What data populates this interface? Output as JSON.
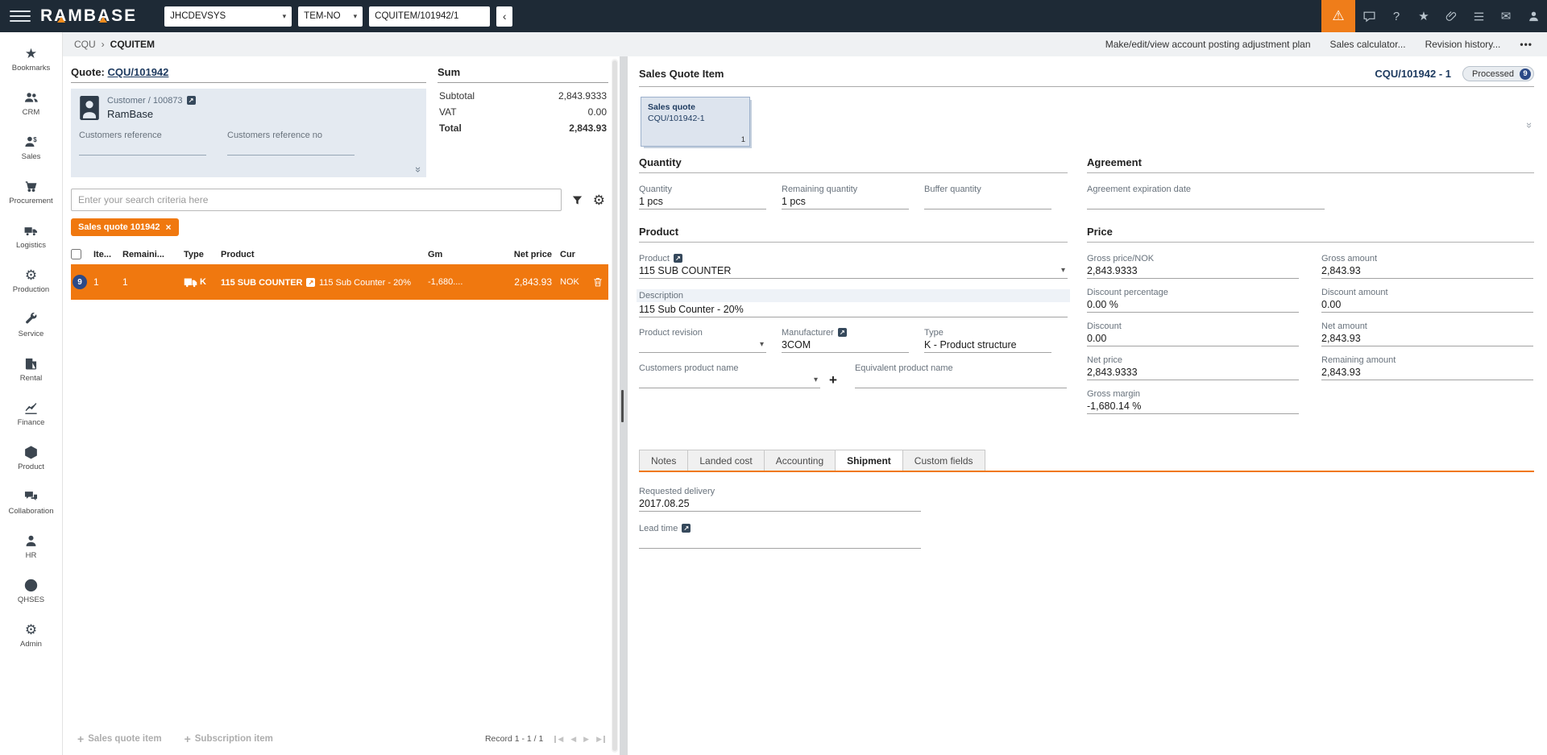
{
  "colors": {
    "accent_orange": "#f0780f",
    "topbar_bg": "#1e2a36",
    "status_blue": "#2c4a87",
    "link_navy": "#1d3a5f"
  },
  "icons": {
    "warning": "⚠",
    "help": "?",
    "star": "★",
    "mail": "✉",
    "gear": "⚙",
    "caret": "▾",
    "back": "‹",
    "crumb_sep": "›",
    "close": "×",
    "plus": "+",
    "collapse": "»",
    "prev": "◀",
    "next": "▶",
    "ext_arrow": "↗",
    "more": "•••"
  },
  "topbar": {
    "logo": "RAMBASE",
    "system_select": "JHCDEVSYS",
    "company_select": "TEM-NO",
    "command_input": "CQUITEM/101942/1"
  },
  "sidebar": {
    "items": [
      {
        "label": "Bookmarks"
      },
      {
        "label": "CRM"
      },
      {
        "label": "Sales"
      },
      {
        "label": "Procurement"
      },
      {
        "label": "Logistics"
      },
      {
        "label": "Production"
      },
      {
        "label": "Service"
      },
      {
        "label": "Rental"
      },
      {
        "label": "Finance"
      },
      {
        "label": "Product"
      },
      {
        "label": "Collaboration"
      },
      {
        "label": "HR"
      },
      {
        "label": "QHSES"
      },
      {
        "label": "Admin"
      }
    ]
  },
  "subheader": {
    "breadcrumb": {
      "parent": "CQU",
      "current": "CQUITEM"
    },
    "actions": [
      {
        "label": "Make/edit/view account posting adjustment plan"
      },
      {
        "label": "Sales calculator..."
      },
      {
        "label": "Revision history..."
      }
    ]
  },
  "quote_panel": {
    "header_label": "Quote:",
    "quote_link": "CQU/101942",
    "customer": {
      "link": "Customer / 100873",
      "name": "RamBase",
      "ref_label": "Customers reference",
      "ref_value": "",
      "ref_no_label": "Customers reference no",
      "ref_no_value": ""
    },
    "sum": {
      "title": "Sum",
      "rows": [
        {
          "label": "Subtotal",
          "value": "2,843.9333"
        },
        {
          "label": "VAT",
          "value": "0.00"
        },
        {
          "label": "Total",
          "value": "2,843.93"
        }
      ]
    },
    "search_placeholder": "Enter your search criteria here",
    "filter_chip": {
      "label": "Sales quote 101942"
    },
    "table": {
      "columns": [
        "Ite...",
        "Remaini...",
        "Type",
        "Product",
        "Gm",
        "Net price",
        "Cur"
      ],
      "rows": [
        {
          "status_badge": "9",
          "item_no": "1",
          "remaining": "1",
          "type": "K",
          "product_name": "115 SUB COUNTER",
          "product_desc": "115 Sub Counter - 20%",
          "gm": "-1,680....",
          "net_price": "2,843.93",
          "currency": "NOK"
        }
      ]
    },
    "footer": {
      "add_item_label": "Sales quote item",
      "add_subscription_label": "Subscription item",
      "record_info": "Record 1 - 1 / 1"
    }
  },
  "detail_panel": {
    "title": "Sales Quote Item",
    "doc_ref": "CQU/101942 - 1",
    "status_label": "Processed",
    "status_count": "9",
    "quote_card": {
      "type_label": "Sales quote",
      "doc_id": "CQU/101942-1",
      "count": "1"
    },
    "quantity_section": {
      "title": "Quantity",
      "fields": [
        {
          "label": "Quantity",
          "value": "1 pcs"
        },
        {
          "label": "Remaining quantity",
          "value": "1 pcs"
        },
        {
          "label": "Buffer quantity",
          "value": ""
        }
      ]
    },
    "agreement_section": {
      "title": "Agreement",
      "fields": [
        {
          "label": "Agreement expiration date",
          "value": ""
        }
      ]
    },
    "product_section": {
      "title": "Product",
      "product": {
        "label": "Product",
        "value": "115 SUB COUNTER"
      },
      "description": {
        "label": "Description",
        "value": "115 Sub Counter - 20%"
      },
      "revision": {
        "label": "Product revision",
        "value": ""
      },
      "manufacturer": {
        "label": "Manufacturer",
        "value": "3COM"
      },
      "type": {
        "label": "Type",
        "value": "K - Product structure"
      },
      "customers_product_name": {
        "label": "Customers product name",
        "value": ""
      },
      "equivalent_product_name": {
        "label": "Equivalent product name",
        "value": ""
      }
    },
    "price_section": {
      "title": "Price",
      "fields": [
        {
          "label": "Gross price/NOK",
          "value": "2,843.9333"
        },
        {
          "label": "Gross amount",
          "value": "2,843.93"
        },
        {
          "label": "Discount percentage",
          "value": "0.00 %"
        },
        {
          "label": "Discount amount",
          "value": "0.00"
        },
        {
          "label": "Discount",
          "value": "0.00"
        },
        {
          "label": "Net amount",
          "value": "2,843.93"
        },
        {
          "label": "Net price",
          "value": "2,843.9333"
        },
        {
          "label": "Remaining amount",
          "value": "2,843.93"
        },
        {
          "label": "Gross margin",
          "value": "-1,680.14 %"
        }
      ]
    },
    "tabs": [
      {
        "label": "Notes",
        "active": false
      },
      {
        "label": "Landed cost",
        "active": false
      },
      {
        "label": "Accounting",
        "active": false
      },
      {
        "label": "Shipment",
        "active": true
      },
      {
        "label": "Custom fields",
        "active": false
      }
    ],
    "shipment_tab": {
      "requested_delivery": {
        "label": "Requested delivery",
        "value": "2017.08.25"
      },
      "lead_time": {
        "label": "Lead time",
        "value": ""
      }
    }
  }
}
